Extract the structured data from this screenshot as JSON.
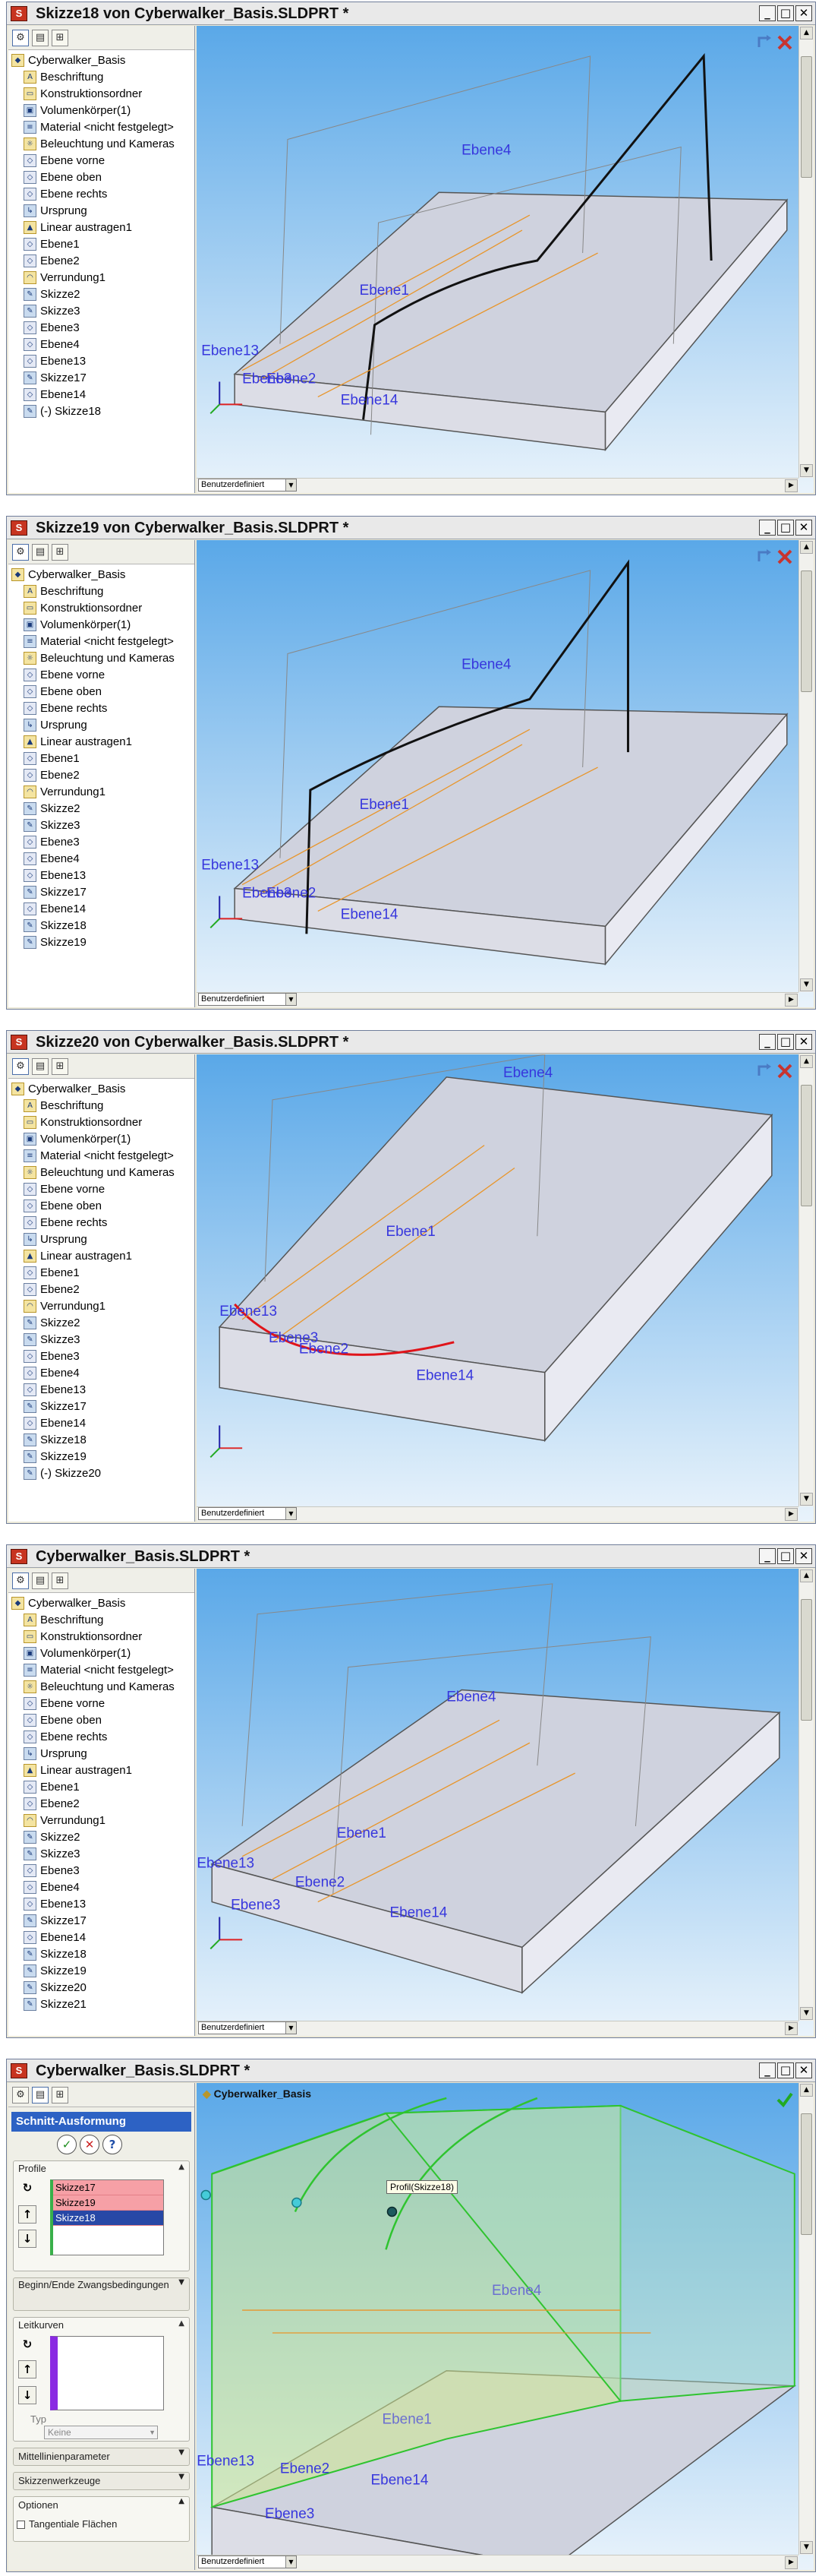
{
  "windows": [
    {
      "title": "Skizze18 von Cyberwalker_Basis.SLDPRT *",
      "config": "Benutzerdefiniert",
      "tree": [
        "Cyberwalker_Basis",
        "Beschriftung",
        "Konstruktionsordner",
        "Volumenkörper(1)",
        "Material <nicht festgelegt>",
        "Beleuchtung und Kameras",
        "Ebene vorne",
        "Ebene oben",
        "Ebene rechts",
        "Ursprung",
        "Linear austragen1",
        "Ebene1",
        "Ebene2",
        "Verrundung1",
        "Skizze2",
        "Skizze3",
        "Ebene3",
        "Ebene4",
        "Ebene13",
        "Skizze17",
        "Ebene14",
        "(-) Skizze18"
      ],
      "labels": [
        "Ebene4",
        "Ebene1",
        "Ebene13",
        "Ebene3",
        "Ebene2",
        "Ebene14"
      ]
    },
    {
      "title": "Skizze19 von Cyberwalker_Basis.SLDPRT *",
      "config": "Benutzerdefiniert",
      "tree": [
        "Cyberwalker_Basis",
        "Beschriftung",
        "Konstruktionsordner",
        "Volumenkörper(1)",
        "Material <nicht festgelegt>",
        "Beleuchtung und Kameras",
        "Ebene vorne",
        "Ebene oben",
        "Ebene rechts",
        "Ursprung",
        "Linear austragen1",
        "Ebene1",
        "Ebene2",
        "Verrundung1",
        "Skizze2",
        "Skizze3",
        "Ebene3",
        "Ebene4",
        "Ebene13",
        "Skizze17",
        "Ebene14",
        "Skizze18",
        "Skizze19"
      ],
      "labels": [
        "Ebene4",
        "Ebene1",
        "Ebene13",
        "Ebene3",
        "Ebene2",
        "Ebene14"
      ]
    },
    {
      "title": "Skizze20 von Cyberwalker_Basis.SLDPRT *",
      "config": "Benutzerdefiniert",
      "tree": [
        "Cyberwalker_Basis",
        "Beschriftung",
        "Konstruktionsordner",
        "Volumenkörper(1)",
        "Material <nicht festgelegt>",
        "Beleuchtung und Kameras",
        "Ebene vorne",
        "Ebene oben",
        "Ebene rechts",
        "Ursprung",
        "Linear austragen1",
        "Ebene1",
        "Ebene2",
        "Verrundung1",
        "Skizze2",
        "Skizze3",
        "Ebene3",
        "Ebene4",
        "Ebene13",
        "Skizze17",
        "Ebene14",
        "Skizze18",
        "Skizze19",
        "(-) Skizze20"
      ],
      "labels": [
        "Ebene4",
        "Ebene1",
        "Ebene13",
        "Ebene3",
        "Ebene2",
        "Ebene14"
      ]
    },
    {
      "title": "Cyberwalker_Basis.SLDPRT *",
      "config": "Benutzerdefiniert",
      "tree": [
        "Cyberwalker_Basis",
        "Beschriftung",
        "Konstruktionsordner",
        "Volumenkörper(1)",
        "Material <nicht festgelegt>",
        "Beleuchtung und Kameras",
        "Ebene vorne",
        "Ebene oben",
        "Ebene rechts",
        "Ursprung",
        "Linear austragen1",
        "Ebene1",
        "Ebene2",
        "Verrundung1",
        "Skizze2",
        "Skizze3",
        "Ebene3",
        "Ebene4",
        "Ebene13",
        "Skizze17",
        "Ebene14",
        "Skizze18",
        "Skizze19",
        "Skizze20",
        "Skizze21"
      ],
      "labels": [
        "Ebene4",
        "Ebene1",
        "Ebene13",
        "Ebene2",
        "Ebene3",
        "Ebene14"
      ]
    },
    {
      "title": "Cyberwalker_Basis.SLDPRT *",
      "config": "Benutzerdefiniert",
      "part_name": "Cyberwalker_Basis",
      "labels": [
        "Ebene4",
        "Ebene1",
        "Ebene13",
        "Ebene2",
        "Ebene3",
        "Ebene14"
      ],
      "tooltip": "Profil(Skizze18)",
      "pm": {
        "title": "Schnitt-Ausformung",
        "profile_header": "Profile",
        "profiles": [
          "Skizze17",
          "Skizze19",
          "Skizze18"
        ],
        "constraints_header": "Beginn/Ende Zwangsbedingungen",
        "guides_header": "Leitkurven",
        "type_label": "Typ",
        "type_value": "Keine",
        "centerline": "Mittellinienparameter",
        "sketchtools": "Skizzenwerkzeuge",
        "options": "Optionen",
        "tangent": "Tangentiale Flächen"
      }
    }
  ]
}
